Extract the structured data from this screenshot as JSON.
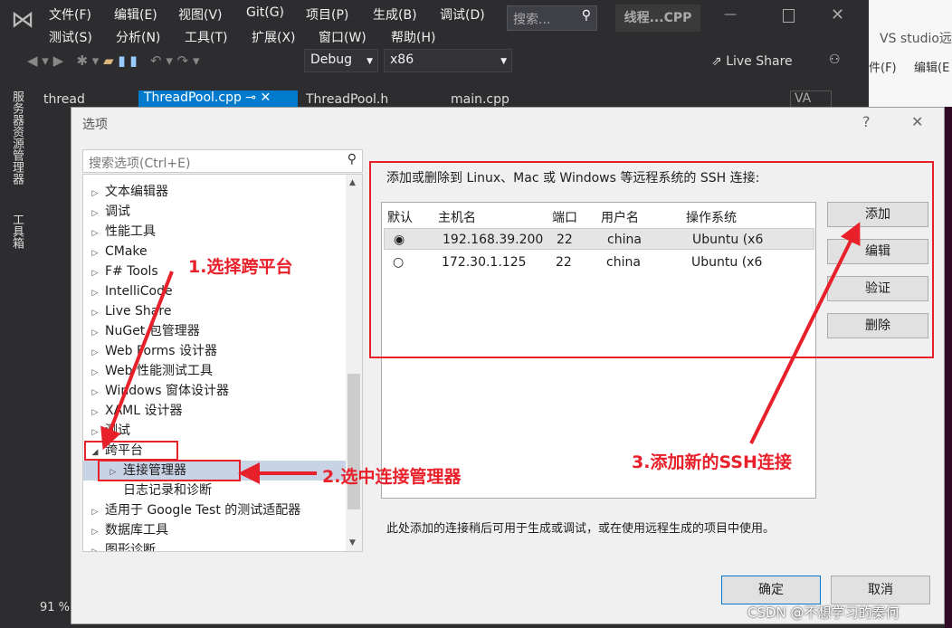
{
  "vs": {
    "menu_row1": [
      "文件(F)",
      "编辑(E)",
      "视图(V)",
      "Git(G)",
      "项目(P)",
      "生成(B)",
      "调试(D)"
    ],
    "menu_row2": [
      "测试(S)",
      "分析(N)",
      "工具(T)",
      "扩展(X)",
      "窗口(W)",
      "帮助(H)"
    ],
    "search_placeholder": "搜索...",
    "solution_title": "线程...CPP",
    "config": "Debug",
    "platform": "x86",
    "live_share": "Live Share",
    "tabs": [
      "thread",
      "ThreadPool.cpp",
      "ThreadPool.h",
      "main.cpp"
    ],
    "side_tabs": [
      "服务器资源管理器",
      "工具箱"
    ],
    "zoom": "91 %",
    "va": "VA"
  },
  "browser": {
    "tab_title": "VS studio远",
    "menu": [
      "件(F)",
      "编辑(E"
    ]
  },
  "dialog": {
    "title": "选项",
    "help": "?",
    "close": "✕",
    "search_placeholder": "搜索选项(Ctrl+E)",
    "tree": [
      {
        "label": "文本编辑器",
        "level": 0,
        "state": "collapsed"
      },
      {
        "label": "调试",
        "level": 0,
        "state": "collapsed"
      },
      {
        "label": "性能工具",
        "level": 0,
        "state": "collapsed"
      },
      {
        "label": "CMake",
        "level": 0,
        "state": "collapsed"
      },
      {
        "label": "F# Tools",
        "level": 0,
        "state": "collapsed"
      },
      {
        "label": "IntelliCode",
        "level": 0,
        "state": "collapsed"
      },
      {
        "label": "Live Share",
        "level": 0,
        "state": "collapsed"
      },
      {
        "label": "NuGet 包管理器",
        "level": 0,
        "state": "collapsed"
      },
      {
        "label": "Web Forms 设计器",
        "level": 0,
        "state": "collapsed"
      },
      {
        "label": "Web 性能测试工具",
        "level": 0,
        "state": "collapsed"
      },
      {
        "label": "Windows 窗体设计器",
        "level": 0,
        "state": "collapsed"
      },
      {
        "label": "XAML 设计器",
        "level": 0,
        "state": "collapsed"
      },
      {
        "label": "测试",
        "level": 0,
        "state": "collapsed"
      },
      {
        "label": "跨平台",
        "level": 0,
        "state": "expanded"
      },
      {
        "label": "连接管理器",
        "level": 1,
        "state": "selected"
      },
      {
        "label": "日志记录和诊断",
        "level": 1,
        "state": "leaf"
      },
      {
        "label": "适用于 Google Test 的测试适配器",
        "level": 0,
        "state": "collapsed"
      },
      {
        "label": "数据库工具",
        "level": 0,
        "state": "collapsed"
      },
      {
        "label": "图形诊断",
        "level": 0,
        "state": "collapsed"
      }
    ],
    "description": "添加或删除到 Linux、Mac 或 Windows 等远程系统的 SSH 连接:",
    "columns": [
      "默认",
      "主机名",
      "端口",
      "用户名",
      "操作系统"
    ],
    "connections": [
      {
        "default": true,
        "host": "192.168.39.200",
        "port": "22",
        "user": "china",
        "os": "Ubuntu (x6"
      },
      {
        "default": false,
        "host": "172.30.1.125",
        "port": "22",
        "user": "china",
        "os": "Ubuntu (x6"
      }
    ],
    "buttons": {
      "add": "添加",
      "edit": "编辑",
      "verify": "验证",
      "delete": "删除"
    },
    "footnote": "此处添加的连接稍后可用于生成或调试，或在使用远程生成的项目中使用。",
    "ok": "确定",
    "cancel": "取消"
  },
  "annotations": {
    "step1": "1.选择跨平台",
    "step2": "2.选中连接管理器",
    "step3": "3.添加新的SSH连接",
    "color": "#e8202a"
  },
  "watermark": "CSDN @不想学习的秦何"
}
